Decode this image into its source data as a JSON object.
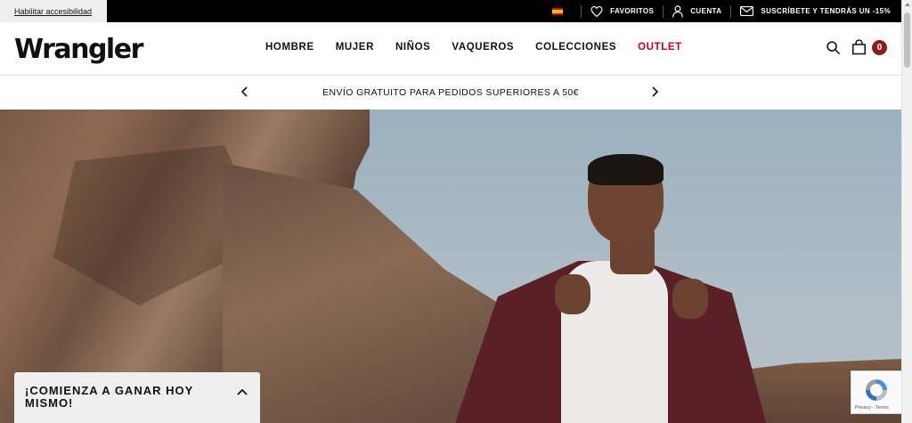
{
  "topbar": {
    "accessibility_label": "Habilitar accesibilidad",
    "favorites_label": "FAVORITOS",
    "account_label": "CUENTA",
    "subscribe_label": "SUSCRÍBETE Y TENDRÁS UN -15%"
  },
  "header": {
    "logo": "Wrangler",
    "nav": [
      "HOMBRE",
      "MUJER",
      "NIÑOS",
      "VAQUEROS",
      "COLECCIONES",
      "OUTLET"
    ],
    "cart_count": "0"
  },
  "promo": {
    "text": "ENVÍO GRATUITO PARA PEDIDOS SUPERIORES A 50€"
  },
  "overlay": {
    "earn_title": "¡COMIENZA A GANAR HOY MISMO!",
    "recaptcha_text": "Privacy - Terms"
  },
  "colors": {
    "topbar_bg": "#000000",
    "outlet_red": "#d0021b",
    "cart_badge": "#8b1c1c"
  }
}
